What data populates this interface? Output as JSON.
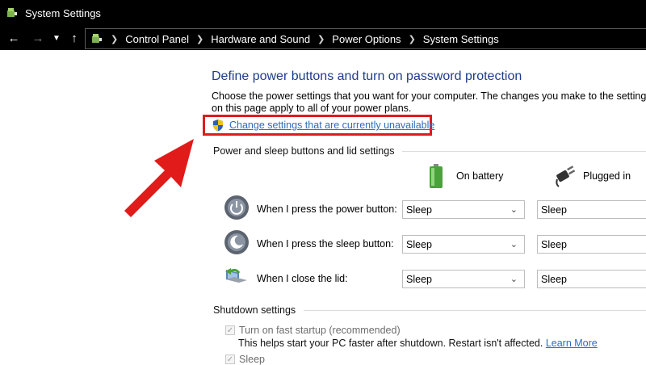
{
  "window": {
    "title": "System Settings"
  },
  "nav": {
    "breadcrumbs": [
      "Control Panel",
      "Hardware and Sound",
      "Power Options",
      "System Settings"
    ]
  },
  "page": {
    "heading": "Define power buttons and turn on password protection",
    "description": "Choose the power settings that you want for your computer. The changes you make to the settings on this page apply to all of your power plans.",
    "change_settings_link": "Change settings that are currently unavailable",
    "section_power_buttons": "Power and sleep buttons and lid settings",
    "col_battery": "On battery",
    "col_plugged": "Plugged in",
    "rows": [
      {
        "label": "When I press the power button:",
        "on_battery": "Sleep",
        "plugged_in": "Sleep"
      },
      {
        "label": "When I press the sleep button:",
        "on_battery": "Sleep",
        "plugged_in": "Sleep"
      },
      {
        "label": "When I close the lid:",
        "on_battery": "Sleep",
        "plugged_in": "Sleep"
      }
    ],
    "section_shutdown": "Shutdown settings",
    "fast_startup_label": "Turn on fast startup (recommended)",
    "fast_startup_help": "This helps start your PC faster after shutdown. Restart isn't affected.",
    "learn_more": "Learn More",
    "sleep_label": "Sleep"
  },
  "colors": {
    "heading": "#1e3c8c",
    "link": "#2a6cc4",
    "highlight": "#e11a1a"
  }
}
